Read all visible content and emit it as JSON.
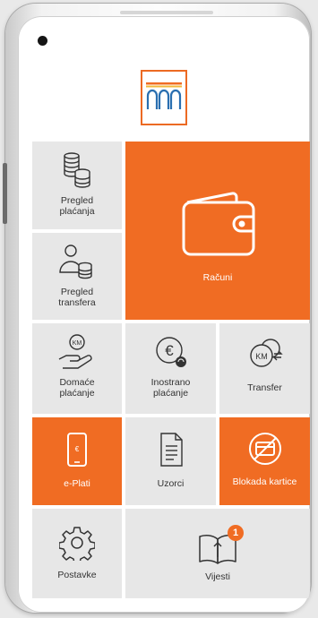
{
  "tiles": {
    "pregled_placanja": "Pregled\nplaćanja",
    "racuni": "Računi",
    "pregled_transfera": "Pregled\ntransfera",
    "domace_placanje": "Domaće\nplaćanje",
    "inostrano_placanje": "Inostrano\nplaćanje",
    "transfer": "Transfer",
    "e_plati": "e-Plati",
    "uzorci": "Uzorci",
    "blokada_kartice": "Blokada kartice",
    "postavke": "Postavke",
    "vijesti": "Vijesti"
  },
  "badges": {
    "vijesti_count": "1"
  },
  "icons": {
    "pregled_placanja": "coins-stack-icon",
    "racuni": "wallet-icon",
    "pregled_transfera": "person-coins-icon",
    "domace_placanje": "hand-km-coin-icon",
    "inostrano_placanje": "euro-coin-icon",
    "transfer": "km-exchange-icon",
    "e_plati": "phone-icon",
    "uzorci": "document-icon",
    "blokada_kartice": "blocked-card-icon",
    "postavke": "gear-icon",
    "vijesti": "open-book-icon"
  },
  "colors": {
    "accent": "#f06c23",
    "tile": "#e7e7e7"
  }
}
